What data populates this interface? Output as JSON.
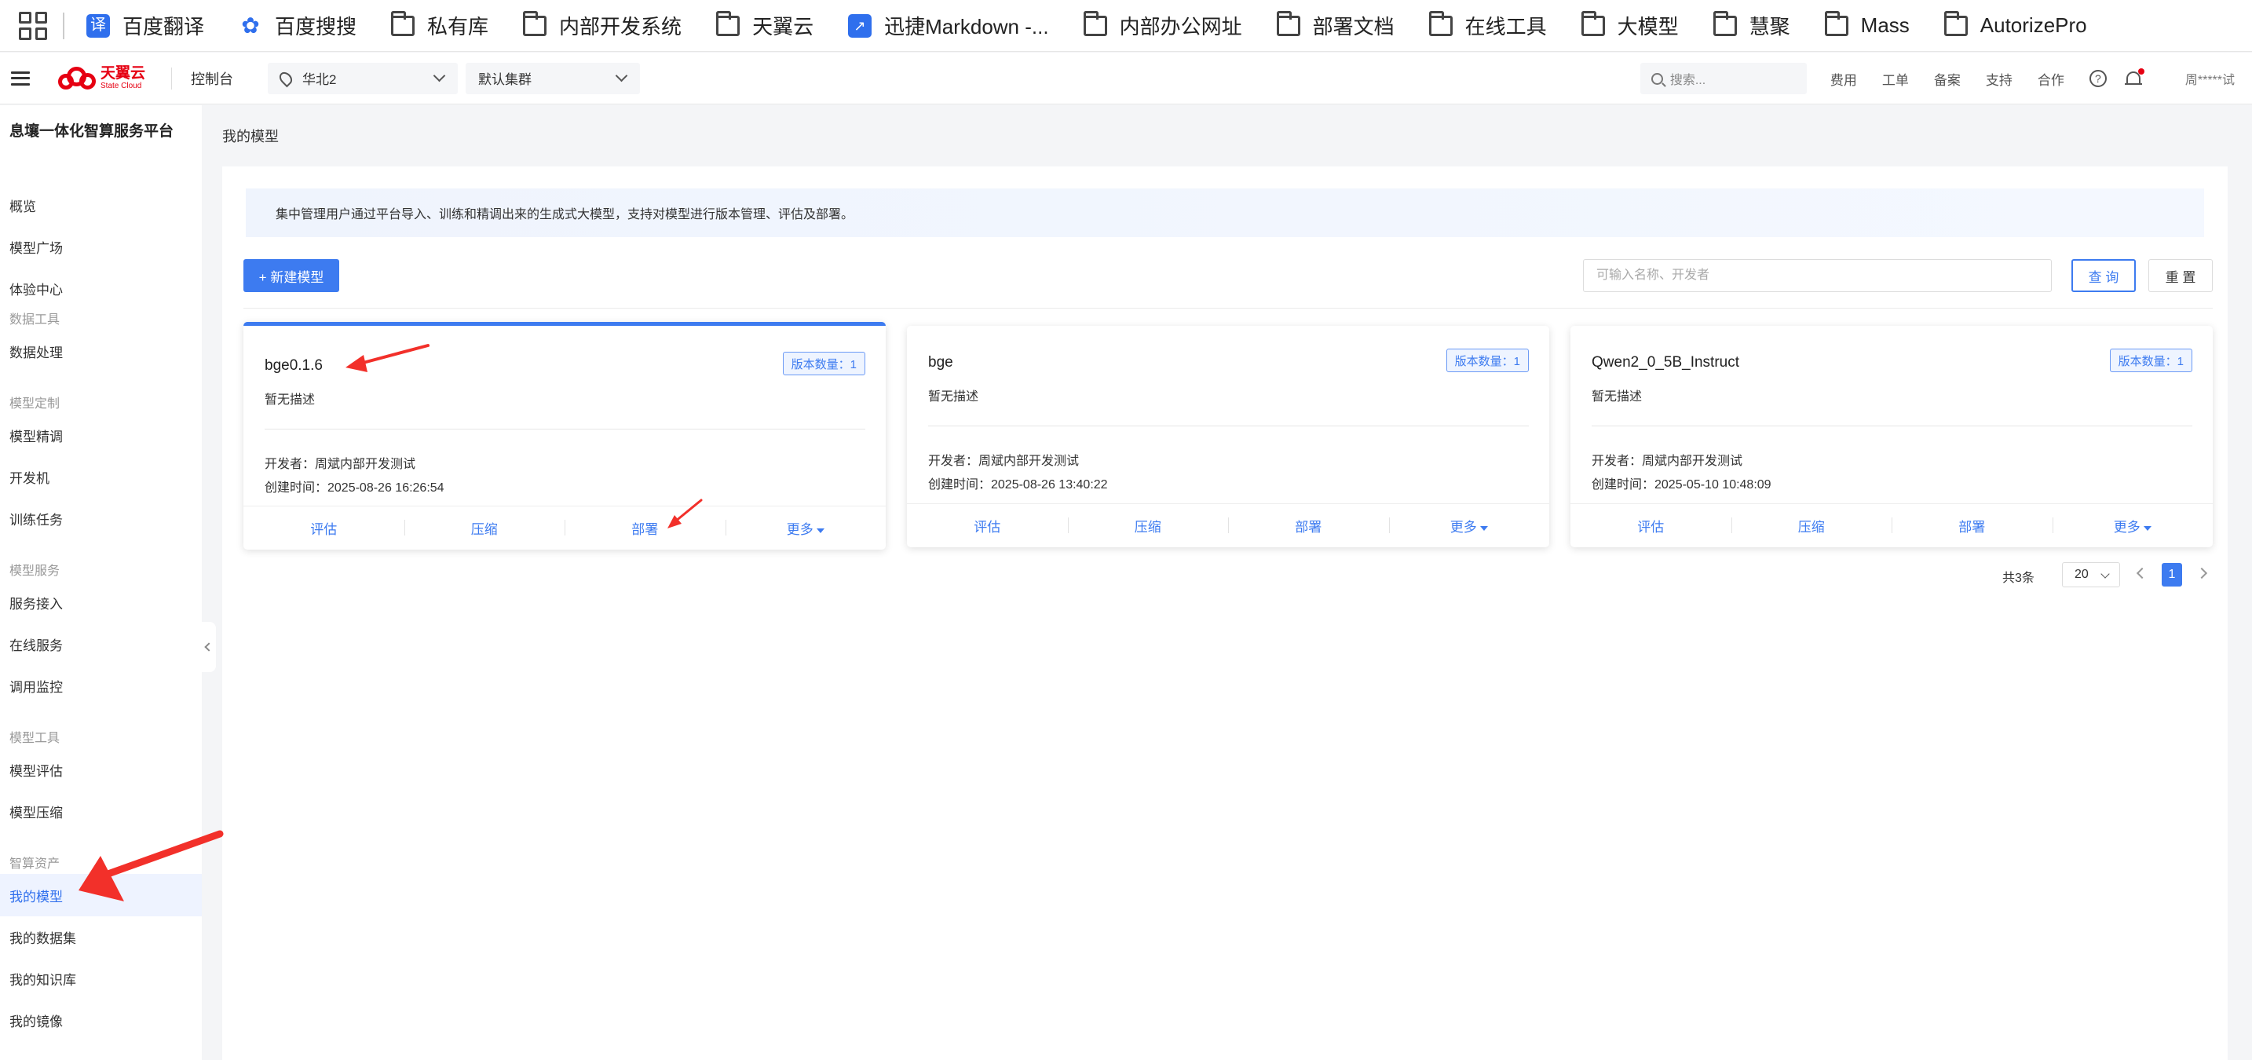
{
  "bookmarks": [
    {
      "label": "百度翻译",
      "icon": "baidu-translate-icon"
    },
    {
      "label": "百度搜搜",
      "icon": "baidu-paw-icon"
    },
    {
      "label": "私有库",
      "icon": "folder-icon"
    },
    {
      "label": "内部开发系统",
      "icon": "folder-icon"
    },
    {
      "label": "天翼云",
      "icon": "folder-icon"
    },
    {
      "label": "迅捷Markdown -...",
      "icon": "markdown-icon"
    },
    {
      "label": "内部办公网址",
      "icon": "folder-icon"
    },
    {
      "label": "部署文档",
      "icon": "folder-icon"
    },
    {
      "label": "在线工具",
      "icon": "folder-icon"
    },
    {
      "label": "大模型",
      "icon": "folder-icon"
    },
    {
      "label": "慧聚",
      "icon": "folder-icon"
    },
    {
      "label": "Mass",
      "icon": "folder-icon"
    },
    {
      "label": "AutorizePro",
      "icon": "folder-icon"
    }
  ],
  "bookmark_glyphs": {
    "translate": "译",
    "paw": "✿",
    "markdown": "↗"
  },
  "topnav": {
    "logo_text": "天翼云",
    "logo_sub": "State Cloud",
    "console": "控制台",
    "region": "华北2",
    "cluster": "默认集群",
    "search_placeholder": "搜索...",
    "links": [
      "费用",
      "工单",
      "备案",
      "支持",
      "合作"
    ],
    "help_glyph": "?",
    "user": "周*****试"
  },
  "sidebar": {
    "title": "息壤一体化智算服务平台",
    "items": [
      "概览",
      "模型广场",
      "体验中心"
    ],
    "groups": [
      {
        "label": "数据工具",
        "items": [
          "数据处理"
        ]
      },
      {
        "label": "模型定制",
        "items": [
          "模型精调",
          "开发机",
          "训练任务"
        ]
      },
      {
        "label": "模型服务",
        "items": [
          "服务接入",
          "在线服务",
          "调用监控"
        ]
      },
      {
        "label": "模型工具",
        "items": [
          "模型评估",
          "模型压缩"
        ]
      },
      {
        "label": "智算资产",
        "items": [
          "我的模型",
          "我的数据集",
          "我的知识库",
          "我的镜像"
        ]
      }
    ],
    "active": "我的模型"
  },
  "page": {
    "breadcrumb": "我的模型",
    "info": "集中管理用户通过平台导入、训练和精调出来的生成式大模型，支持对模型进行版本管理、评估及部署。",
    "new_button": "+ 新建模型",
    "query_placeholder": "可输入名称、开发者",
    "query_button": "查 询",
    "reset_button": "重 置"
  },
  "cards": [
    {
      "name": "bge0.1.6",
      "badge": "版本数量：1",
      "desc": "暂无描述",
      "developer": "开发者：周斌内部开发测试",
      "created": "创建时间：2025-08-26 16:26:54",
      "selected": true
    },
    {
      "name": "bge",
      "badge": "版本数量：1",
      "desc": "暂无描述",
      "developer": "开发者：周斌内部开发测试",
      "created": "创建时间：2025-08-26 13:40:22",
      "selected": false
    },
    {
      "name": "Qwen2_0_5B_Instruct",
      "badge": "版本数量：1",
      "desc": "暂无描述",
      "developer": "开发者：周斌内部开发测试",
      "created": "创建时间：2025-05-10 10:48:09",
      "selected": false
    }
  ],
  "card_actions": [
    "评估",
    "压缩",
    "部署",
    "更多"
  ],
  "pagination": {
    "total": "共3条",
    "page_size": "20",
    "current": "1"
  },
  "colors": {
    "accent": "#3d7bf0",
    "brand": "#e60012",
    "annotation": "#f2302a"
  }
}
